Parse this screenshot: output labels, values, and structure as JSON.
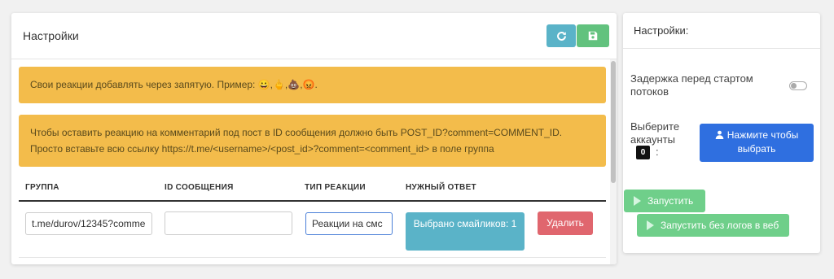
{
  "main": {
    "title": "Настройки",
    "refresh_icon": "refresh-icon",
    "save_icon": "save-icon",
    "alert1_text": "Свои реакции добавлять через запятую. Пример: ",
    "alert1_emojis": "😀,🖕,💩,😡.",
    "alert2_text": "Чтобы оставить реакцию на комментарий под пост в ID сообщения должно быть POST_ID?comment=COMMENT_ID. Просто вставьте всю ссылку https://t.me/<username>/<post_id>?comment=<comment_id> в поле группа",
    "columns": [
      "ГРУППА",
      "ID СООБЩЕНИЯ",
      "ТИП РЕАКЦИИ",
      "НУЖНЫЙ ОТВЕТ"
    ],
    "row": {
      "group_value": "t.me/durov/12345?comme",
      "message_id_value": "",
      "reaction_type_value": "Реакции на смс",
      "answer_button": "Выбрано смайликов: 1",
      "delete_button": "Удалить"
    }
  },
  "side": {
    "title": "Настройки:",
    "delay_label": "Задержка перед стартом потоков",
    "accounts_label": "Выберите аккаунты",
    "accounts_colon": ":",
    "accounts_count": "0",
    "select_button": "Нажмите чтобы выбрать",
    "start_button": "Запустить",
    "start_nolog_button": "Запустить без логов в веб"
  },
  "colors": {
    "info": "#5ab3c8",
    "success": "#62c27e",
    "warning": "#f3bc4b",
    "danger": "#e0666e",
    "primary": "#2f6fe0"
  }
}
